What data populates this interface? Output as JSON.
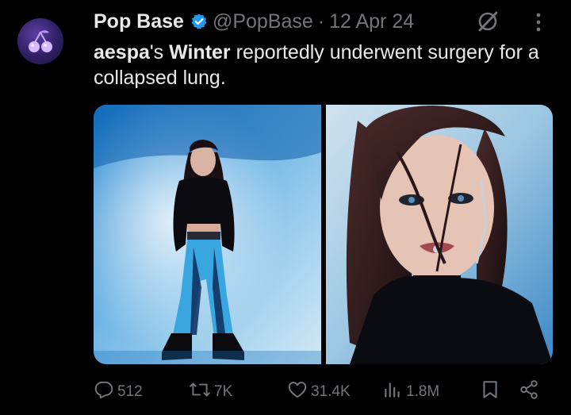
{
  "author": {
    "name": "Pop Base",
    "handle": "@PopBase",
    "separator": "·",
    "date": "12 Apr 24",
    "avatar_icon": "cherry-logo-icon",
    "verified_color": "#1d9bf0"
  },
  "tweet": {
    "part1": "aespa",
    "part2": "'s ",
    "part3": "Winter",
    "part4": " reportedly underwent surgery for a collapsed lung."
  },
  "media": {
    "count": 2,
    "photos": [
      {
        "kind": "full-body-photo"
      },
      {
        "kind": "portrait-photo"
      }
    ]
  },
  "actions": {
    "replies": "512",
    "reposts": "7K",
    "likes": "31.4K",
    "views": "1.8M"
  },
  "icons": {
    "reply": "reply-icon",
    "repost": "repost-icon",
    "like": "heart-icon",
    "views": "views-chart-icon",
    "bookmark": "bookmark-icon",
    "share": "share-icon",
    "grok": "grok-icon",
    "more": "more-vertical-icon"
  },
  "colors": {
    "background": "#000000",
    "text": "#e7e9ea",
    "muted": "#71767b",
    "accent": "#1d9bf0"
  }
}
